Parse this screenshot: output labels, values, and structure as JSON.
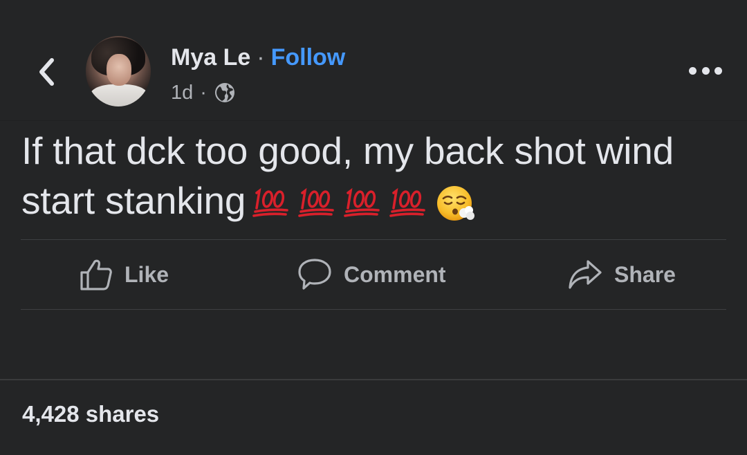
{
  "header": {
    "author_name": "Mya Le",
    "separator": "·",
    "follow_label": "Follow",
    "timestamp": "1d",
    "meta_separator": "·",
    "privacy_icon": "globe-icon",
    "back_icon": "chevron-left-icon",
    "more_icon": "more-horizontal-icon"
  },
  "post": {
    "text": "If that dck too good, my back shot wind start stanking",
    "emojis": [
      "💯",
      "💯",
      "💯",
      "💯",
      "😮‍💨"
    ]
  },
  "actions": {
    "like_label": "Like",
    "comment_label": "Comment",
    "share_label": "Share"
  },
  "footer": {
    "shares_text": "4,428 shares"
  },
  "colors": {
    "background": "#242526",
    "text_primary": "#e4e6eb",
    "text_secondary": "#b0b3b8",
    "link": "#4599ff",
    "hundred_red": "#d9202b"
  }
}
